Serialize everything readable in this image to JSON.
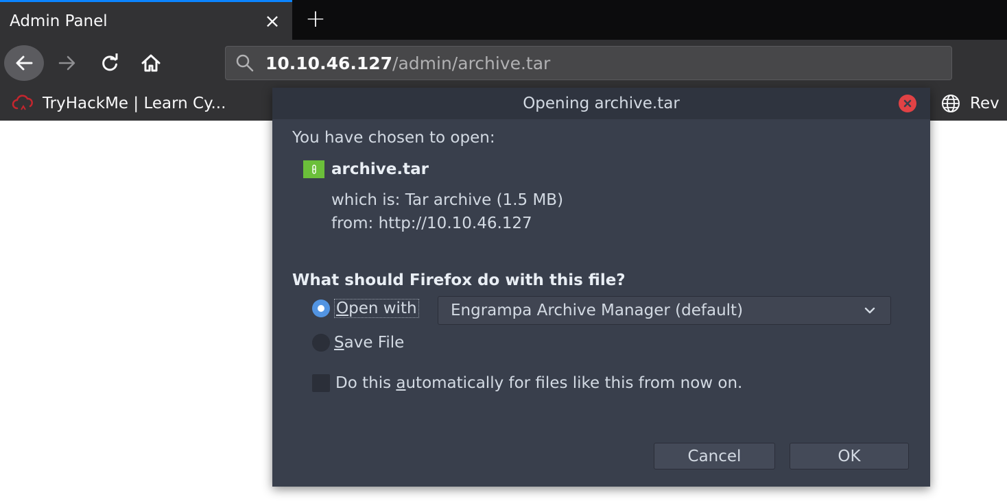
{
  "tab": {
    "title": "Admin Panel",
    "close_glyph": "×",
    "new_tab_glyph": "+"
  },
  "navbar": {
    "back_icon": "arrow-left-icon",
    "forward_icon": "arrow-right-icon",
    "reload_icon": "reload-icon",
    "home_icon": "home-icon",
    "url_host": "10.10.46.127",
    "url_path": "/admin/archive.tar"
  },
  "bookmarks": [
    {
      "label": "TryHackMe | Learn Cy...",
      "icon": "tryhackme-cloud-icon"
    },
    {
      "label": "Rev",
      "icon": "globe-icon"
    }
  ],
  "dialog": {
    "title": "Opening archive.tar",
    "chosen_text": "You have chosen to open:",
    "file_name": "archive.tar",
    "which_is_label": "which is:",
    "which_is_value": "Tar archive (1.5 MB)",
    "from_label": "from:",
    "from_value": "http://10.10.46.127",
    "question": "What should Firefox do with this file?",
    "open_with_label": "Open with",
    "open_with_selected": true,
    "app_selected": "Engrampa Archive Manager (default)",
    "save_file_label": "Save File",
    "auto_label": "Do this automatically for files like this from now on.",
    "auto_checked": false,
    "cancel_label": "Cancel",
    "ok_label": "OK"
  },
  "colors": {
    "tab_accent": "#0a84ff",
    "dialog_bg": "#393f4c",
    "radio_accent": "#5294e2",
    "close_red": "#e14245",
    "file_icon_green": "#6bbf3a"
  }
}
